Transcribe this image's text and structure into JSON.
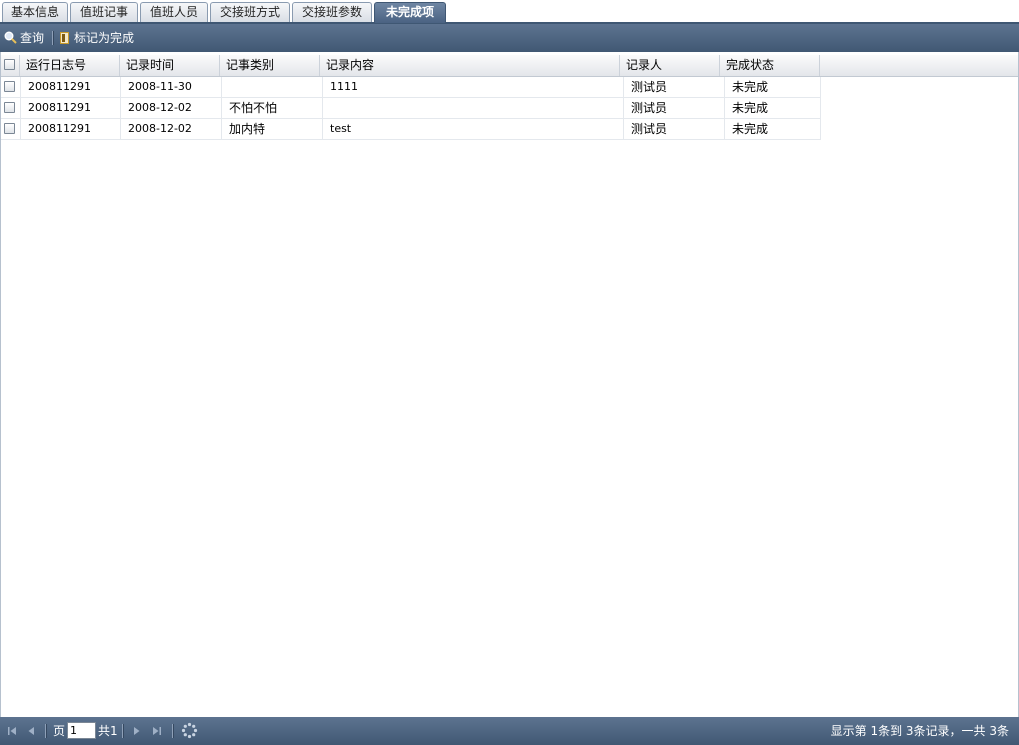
{
  "tabs": [
    {
      "label": "基本信息",
      "active": false
    },
    {
      "label": "值班记事",
      "active": false
    },
    {
      "label": "值班人员",
      "active": false
    },
    {
      "label": "交接班方式",
      "active": false
    },
    {
      "label": "交接班参数",
      "active": false
    },
    {
      "label": "未完成项",
      "active": true
    }
  ],
  "toolbar": {
    "query_label": "查询",
    "query_icon": "search-icon",
    "mark_done_label": "标记为完成",
    "mark_done_icon": "document-icon"
  },
  "grid": {
    "columns": [
      "运行日志号",
      "记录时间",
      "记事类别",
      "记录内容",
      "记录人",
      "完成状态"
    ],
    "rows": [
      {
        "log_no": "200811291",
        "time": "2008-11-30",
        "category": "",
        "content": "1111",
        "recorder": "测试员",
        "status": "未完成"
      },
      {
        "log_no": "200811291",
        "time": "2008-12-02",
        "category": "不怕不怕",
        "content": "",
        "recorder": "测试员",
        "status": "未完成"
      },
      {
        "log_no": "200811291",
        "time": "2008-12-02",
        "category": "加内特",
        "content": "test",
        "recorder": "测试员",
        "status": "未完成"
      }
    ]
  },
  "pager": {
    "page_label": "页",
    "page_value": "1",
    "total_label": "共1",
    "info": "显示第 1条到 3条记录，一共 3条"
  },
  "colors": {
    "toolbar_bg": "#4f6682",
    "active_tab_bg": "#5a7191",
    "header_bg": "#e8ebef"
  }
}
